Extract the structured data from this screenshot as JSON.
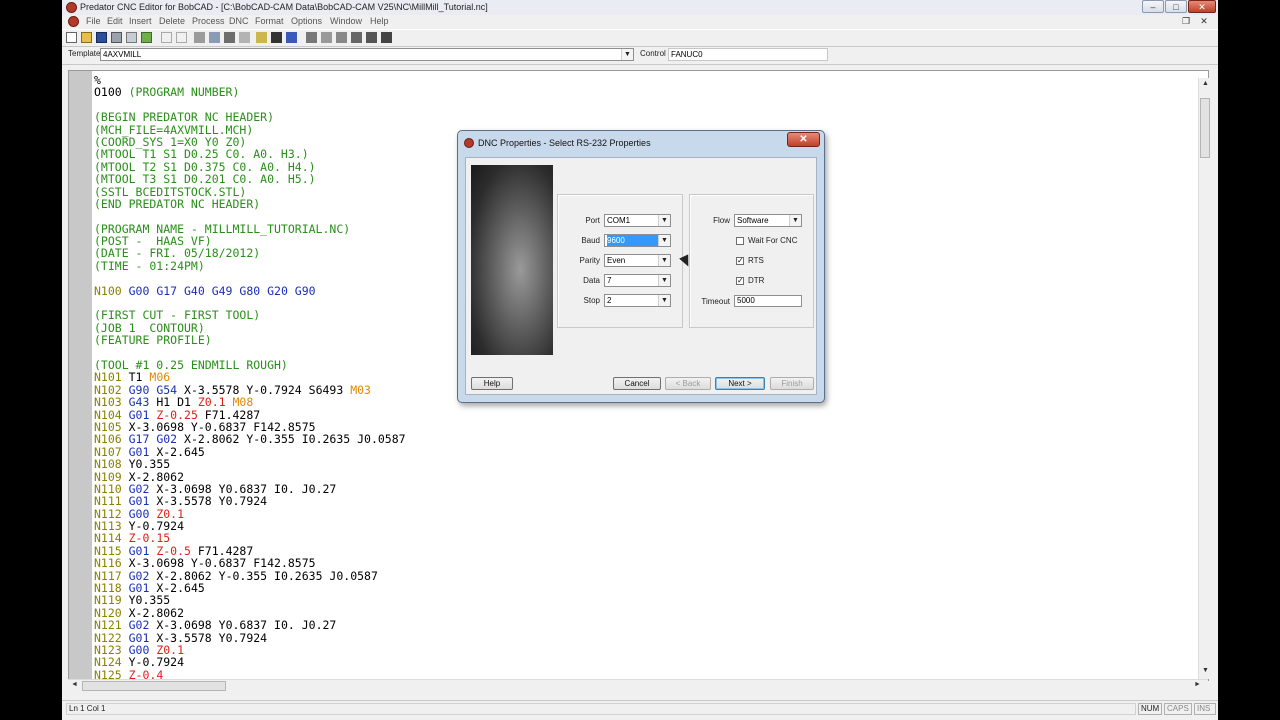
{
  "window": {
    "title": "Predator CNC Editor for BobCAD - [C:\\BobCAD-CAM Data\\BobCAD-CAM V25\\NC\\MillMill_Tutorial.nc]",
    "min": "–",
    "max": "□",
    "close": "✕"
  },
  "menu": [
    "File",
    "Edit",
    "Insert",
    "Delete",
    "Process",
    "DNC",
    "Format",
    "Options",
    "Window",
    "Help"
  ],
  "template": {
    "label": "Template",
    "value": "4AXVMILL",
    "control_label": "Control",
    "control_value": "FANUC0"
  },
  "code_lines": [
    [
      [
        "%",
        "k"
      ]
    ],
    [
      [
        "O100 ",
        "k"
      ],
      [
        "(PROGRAM NUMBER)",
        "g"
      ]
    ],
    [
      [
        "",
        "k"
      ]
    ],
    [
      [
        "(BEGIN PREDATOR NC HEADER)",
        "g"
      ]
    ],
    [
      [
        "(MCH_FILE=4AXVMILL.MCH)",
        "g"
      ]
    ],
    [
      [
        "(COORD_SYS 1=X0 Y0 Z0)",
        "g"
      ]
    ],
    [
      [
        "(MTOOL T1 S1 D0.25 C0. A0. H3.)",
        "g"
      ]
    ],
    [
      [
        "(MTOOL T2 S1 D0.375 C0. A0. H4.)",
        "g"
      ]
    ],
    [
      [
        "(MTOOL T3 S1 D0.201 C0. A0. H5.)",
        "g"
      ]
    ],
    [
      [
        "(SSTL BCEDITSTOCK.STL)",
        "g"
      ]
    ],
    [
      [
        "(END PREDATOR NC HEADER)",
        "g"
      ]
    ],
    [
      [
        "",
        "k"
      ]
    ],
    [
      [
        "(PROGRAM NAME - MILLMILL_TUTORIAL.NC)",
        "g"
      ]
    ],
    [
      [
        "(POST -  HAAS VF)",
        "g"
      ]
    ],
    [
      [
        "(DATE - FRI. 05/18/2012)",
        "g"
      ]
    ],
    [
      [
        "(TIME - 01:24PM)",
        "g"
      ]
    ],
    [
      [
        "",
        "k"
      ]
    ],
    [
      [
        "N100 ",
        "n"
      ],
      [
        "G00 G17 G40 G49 G80 G20 G90",
        "b"
      ]
    ],
    [
      [
        "",
        "k"
      ]
    ],
    [
      [
        "(FIRST CUT - FIRST TOOL)",
        "g"
      ]
    ],
    [
      [
        "(JOB 1  CONTOUR)",
        "g"
      ]
    ],
    [
      [
        "(FEATURE PROFILE)",
        "g"
      ]
    ],
    [
      [
        "",
        "k"
      ]
    ],
    [
      [
        "(TOOL #1 0.25 ENDMILL ROUGH)",
        "g"
      ]
    ],
    [
      [
        "N101 ",
        "n"
      ],
      [
        "T1 ",
        "k"
      ],
      [
        "M06",
        "o"
      ]
    ],
    [
      [
        "N102 ",
        "n"
      ],
      [
        "G90 G54 ",
        "b"
      ],
      [
        "X-3.5578 Y-0.7924 S6493 ",
        "k"
      ],
      [
        "M03",
        "o"
      ]
    ],
    [
      [
        "N103 ",
        "n"
      ],
      [
        "G43 ",
        "b"
      ],
      [
        "H1 D1 ",
        "k"
      ],
      [
        "Z0.1 ",
        "r"
      ],
      [
        "M08",
        "o"
      ]
    ],
    [
      [
        "N104 ",
        "n"
      ],
      [
        "G01 ",
        "b"
      ],
      [
        "Z-0.25 ",
        "r"
      ],
      [
        "F71.4287",
        "k"
      ]
    ],
    [
      [
        "N105 ",
        "n"
      ],
      [
        "X-3.0698 Y-0.6837 F142.8575",
        "k"
      ]
    ],
    [
      [
        "N106 ",
        "n"
      ],
      [
        "G17 G02 ",
        "b"
      ],
      [
        "X-2.8062 Y-0.355 I0.2635 J0.0587",
        "k"
      ]
    ],
    [
      [
        "N107 ",
        "n"
      ],
      [
        "G01 ",
        "b"
      ],
      [
        "X-2.645",
        "k"
      ]
    ],
    [
      [
        "N108 ",
        "n"
      ],
      [
        "Y0.355",
        "k"
      ]
    ],
    [
      [
        "N109 ",
        "n"
      ],
      [
        "X-2.8062",
        "k"
      ]
    ],
    [
      [
        "N110 ",
        "n"
      ],
      [
        "G02 ",
        "b"
      ],
      [
        "X-3.0698 Y0.6837 I0. J0.27",
        "k"
      ]
    ],
    [
      [
        "N111 ",
        "n"
      ],
      [
        "G01 ",
        "b"
      ],
      [
        "X-3.5578 Y0.7924",
        "k"
      ]
    ],
    [
      [
        "N112 ",
        "n"
      ],
      [
        "G00 ",
        "b"
      ],
      [
        "Z0.1",
        "r"
      ]
    ],
    [
      [
        "N113 ",
        "n"
      ],
      [
        "Y-0.7924",
        "k"
      ]
    ],
    [
      [
        "N114 ",
        "n"
      ],
      [
        "Z-0.15",
        "r"
      ]
    ],
    [
      [
        "N115 ",
        "n"
      ],
      [
        "G01 ",
        "b"
      ],
      [
        "Z-0.5 ",
        "r"
      ],
      [
        "F71.4287",
        "k"
      ]
    ],
    [
      [
        "N116 ",
        "n"
      ],
      [
        "X-3.0698 Y-0.6837 F142.8575",
        "k"
      ]
    ],
    [
      [
        "N117 ",
        "n"
      ],
      [
        "G02 ",
        "b"
      ],
      [
        "X-2.8062 Y-0.355 I0.2635 J0.0587",
        "k"
      ]
    ],
    [
      [
        "N118 ",
        "n"
      ],
      [
        "G01 ",
        "b"
      ],
      [
        "X-2.645",
        "k"
      ]
    ],
    [
      [
        "N119 ",
        "n"
      ],
      [
        "Y0.355",
        "k"
      ]
    ],
    [
      [
        "N120 ",
        "n"
      ],
      [
        "X-2.8062",
        "k"
      ]
    ],
    [
      [
        "N121 ",
        "n"
      ],
      [
        "G02 ",
        "b"
      ],
      [
        "X-3.0698 Y0.6837 I0. J0.27",
        "k"
      ]
    ],
    [
      [
        "N122 ",
        "n"
      ],
      [
        "G01 ",
        "b"
      ],
      [
        "X-3.5578 Y0.7924",
        "k"
      ]
    ],
    [
      [
        "N123 ",
        "n"
      ],
      [
        "G00 ",
        "b"
      ],
      [
        "Z0.1",
        "r"
      ]
    ],
    [
      [
        "N124 ",
        "n"
      ],
      [
        "Y-0.7924",
        "k"
      ]
    ],
    [
      [
        "N125 ",
        "n"
      ],
      [
        "Z-0.4",
        "r"
      ]
    ]
  ],
  "colors": {
    "k": "#000000",
    "g": "#2a8f1a",
    "n": "#8b7f00",
    "b": "#1a2fb8",
    "r": "#e0201a",
    "o": "#e08a00"
  },
  "dialog": {
    "title": "DNC Properties - Select RS-232 Properties",
    "close": "✕",
    "port_label": "Port",
    "port_value": "COM1",
    "baud_label": "Baud",
    "baud_value": "9600",
    "parity_label": "Parity",
    "parity_value": "Even",
    "data_label": "Data",
    "data_value": "7",
    "stop_label": "Stop",
    "stop_value": "2",
    "flow_label": "Flow",
    "flow_value": "Software",
    "wait_label": "Wait For CNC",
    "rts_label": "RTS",
    "dtr_label": "DTR",
    "timeout_label": "Timeout",
    "timeout_value": "5000",
    "help": "Help",
    "cancel": "Cancel",
    "back": "< Back",
    "next": "Next >",
    "finish": "Finish"
  },
  "status": {
    "position": "Ln 1 Col 1",
    "num": "NUM",
    "caps": "CAPS",
    "ins": "INS"
  }
}
